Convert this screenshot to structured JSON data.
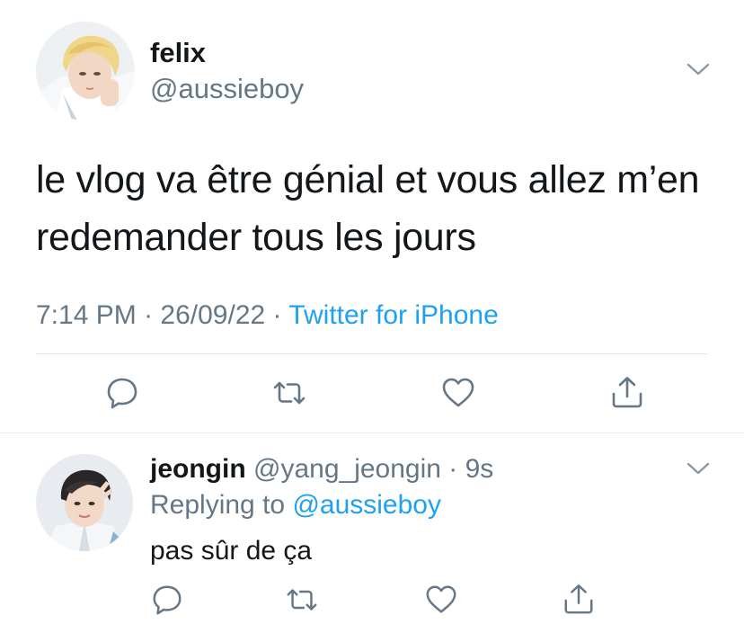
{
  "main_tweet": {
    "name": "felix",
    "handle": "@aussieboy",
    "text": "le vlog va être génial et vous allez m’en redemander tous les jours",
    "time": "7:14 PM",
    "sep1": " · ",
    "date": "26/09/22",
    "sep2": " · ",
    "source": "Twitter for iPhone"
  },
  "reply_tweet": {
    "name": "jeongin",
    "handle": "@yang_jeongin",
    "sep": " · ",
    "age": "9s",
    "replying_prefix": "Replying to ",
    "replying_handle": "@aussieboy",
    "text": "pas sûr de ça"
  },
  "icons": {
    "reply": "comment-bubble-icon",
    "retweet": "retweet-arrows-icon",
    "like": "heart-icon",
    "share": "share-upload-icon",
    "more": "chevron-down-icon"
  },
  "colors": {
    "text": "#14171a",
    "secondary": "#657786",
    "link": "#1da1f2",
    "divider": "#e1e8ed"
  }
}
